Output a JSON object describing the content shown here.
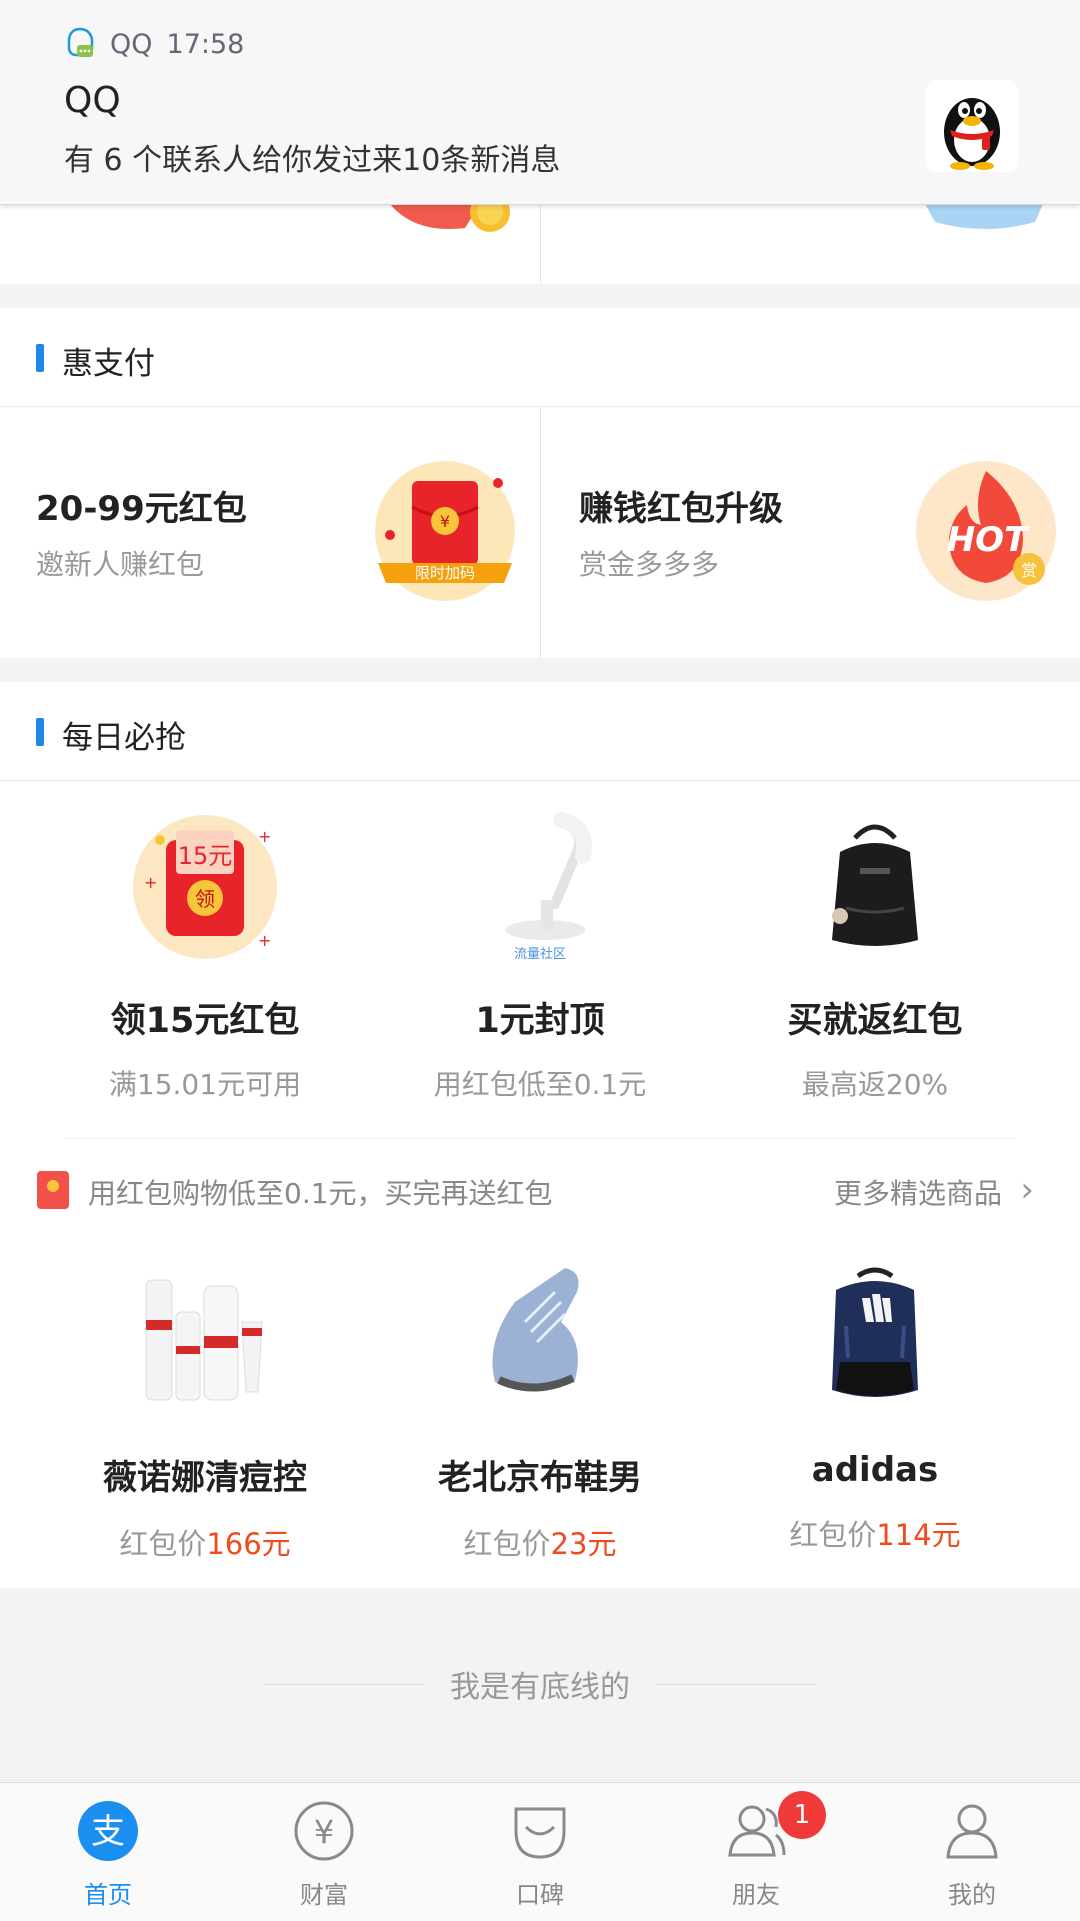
{
  "notification": {
    "app_name": "QQ",
    "time": "17:58",
    "title": "QQ",
    "body": "有 6 个联系人给你发过来10条新消息"
  },
  "hui_pay": {
    "section_title": "惠支付",
    "cards": [
      {
        "title": "20-99元红包",
        "subtitle": "邀新人赚红包",
        "badge_text": "限时加码",
        "icon": "red-envelope-icon"
      },
      {
        "title": "赚钱红包升级",
        "subtitle": "赏金多多多",
        "badge_text": "HOT",
        "badge_sub": "赏",
        "icon": "hot-flame-icon"
      }
    ]
  },
  "daily_deals": {
    "section_title": "每日必抢",
    "items": [
      {
        "title": "领15元红包",
        "subtitle": "满15.01元可用",
        "image_text": "15元",
        "image_badge": "领",
        "icon": "red-envelope-icon"
      },
      {
        "title": "1元封顶",
        "subtitle": "用红包低至0.1元",
        "image_caption": "流量社区",
        "icon": "desk-lamp-icon"
      },
      {
        "title": "买就返红包",
        "subtitle": "最高返20%",
        "icon": "backpack-icon"
      }
    ]
  },
  "promo_strip": {
    "text": "用红包购物低至0.1元，买完再送红包",
    "more_label": "更多精选商品"
  },
  "products": [
    {
      "name": "薇诺娜清痘控",
      "price_label": "红包价",
      "price": "166元",
      "icon": "skincare-bottles-icon"
    },
    {
      "name": "老北京布鞋男",
      "price_label": "红包价",
      "price": "23元",
      "icon": "sneaker-icon"
    },
    {
      "name": "adidas",
      "price_label": "红包价",
      "price": "114元",
      "icon": "adidas-backpack-icon"
    }
  ],
  "footer_text": "我是有底线的",
  "tabbar": {
    "tabs": [
      {
        "label": "首页",
        "icon": "alipay-home-icon",
        "active": true
      },
      {
        "label": "财富",
        "icon": "yuan-coin-icon"
      },
      {
        "label": "口碑",
        "icon": "koubei-icon"
      },
      {
        "label": "朋友",
        "icon": "friends-icon",
        "badge": "1"
      },
      {
        "label": "我的",
        "icon": "profile-icon"
      }
    ]
  },
  "colors": {
    "accent": "#1a8ff0",
    "price_red": "#f04a1d",
    "badge_red": "#f03a3a",
    "section_bar": "#1e88e5"
  }
}
